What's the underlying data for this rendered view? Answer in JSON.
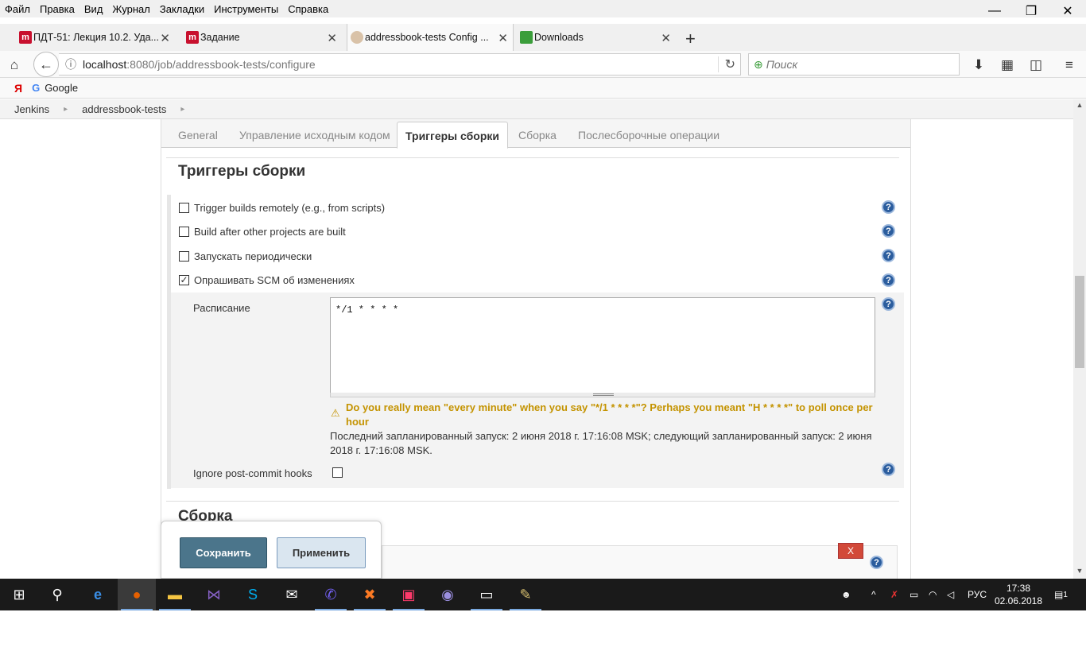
{
  "menu": [
    "Файл",
    "Правка",
    "Вид",
    "Журнал",
    "Закладки",
    "Инструменты",
    "Справка"
  ],
  "window_controls": {
    "minimize": "—",
    "restore": "❐",
    "close": "✕"
  },
  "tabs": [
    {
      "title": "ПДТ-51: Лекция 10.2. Уда...",
      "favicon": "m-icon"
    },
    {
      "title": "Задание",
      "favicon": "m-icon"
    },
    {
      "title": "addressbook-tests Config ...",
      "favicon": "jenkins-icon"
    },
    {
      "title": "Downloads",
      "favicon": "downloads-icon"
    }
  ],
  "url": {
    "host": "localhost",
    "rest": ":8080/job/addressbook-tests/configure"
  },
  "search": {
    "placeholder": "Поиск"
  },
  "bookmarks": {
    "yandex": "Я",
    "google_logo": "G",
    "google": "Google"
  },
  "breadcrumb": [
    "Jenkins",
    "addressbook-tests"
  ],
  "config_tabs": [
    "General",
    "Управление исходным кодом",
    "Триггеры сборки",
    "Сборка",
    "Послесборочные операции"
  ],
  "active_config_tab": "Триггеры сборки",
  "section_title": "Триггеры сборки",
  "triggers": [
    {
      "label": "Trigger builds remotely (e.g., from scripts)",
      "checked": false
    },
    {
      "label": "Build after other projects are built",
      "checked": false
    },
    {
      "label": "Запускать периодически",
      "checked": false
    },
    {
      "label": "Опрашивать SCM об изменениях",
      "checked": true
    }
  ],
  "schedule": {
    "label": "Расписание",
    "value": "*/1 * * * *",
    "warning": "Do you really mean \"every minute\" when you say \"*/1 * * * *\"? Perhaps you meant \"H * * * *\" to poll once per hour",
    "info": "Последний запланированный запуск: 2 июня 2018 г. 17:16:08 MSK; следующий запланированный запуск: 2 июня 2018 г. 17:16:08 MSK."
  },
  "ignore_hooks": {
    "label": "Ignore post-commit hooks",
    "checked": false
  },
  "next_section_title": "Сборка",
  "buttons": {
    "save": "Сохранить",
    "apply": "Применить",
    "remove": "X"
  },
  "help_glyph": "?",
  "taskbar": {
    "language": "РУС",
    "time": "17:38",
    "date": "02.06.2018",
    "notifications": "1"
  }
}
